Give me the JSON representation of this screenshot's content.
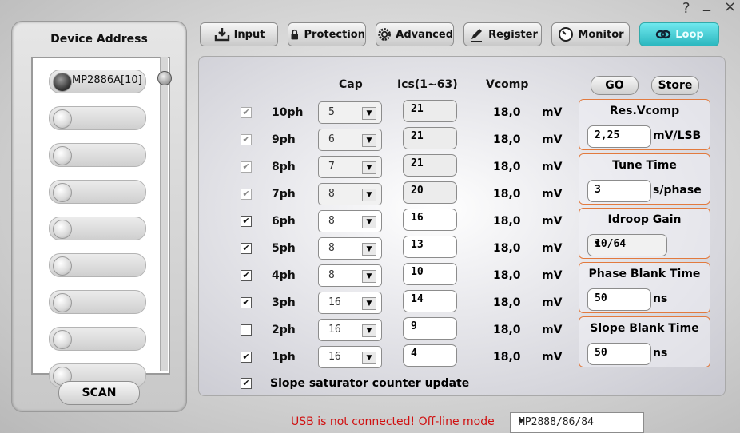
{
  "window": {
    "help_glyph": "?",
    "minimize_glyph": "_",
    "close_glyph": "×"
  },
  "device_panel": {
    "title": "Device Address",
    "devices": [
      "MP2886A[10]",
      "",
      "",
      "",
      "",
      "",
      "",
      "",
      ""
    ],
    "scan_label": "SCAN"
  },
  "tabs": [
    {
      "label": "Input",
      "icon": "download-tray-icon"
    },
    {
      "label": "Protection",
      "icon": "lock-icon"
    },
    {
      "label": "Advanced",
      "icon": "gear-icon"
    },
    {
      "label": "Register",
      "icon": "pen-icon"
    },
    {
      "label": "Monitor",
      "icon": "gauge-icon"
    },
    {
      "label": "Loop",
      "icon": "loop-link-icon",
      "active": true
    }
  ],
  "table": {
    "headers": {
      "cap": "Cap",
      "ics": "Ics(1~63)",
      "vcomp": "Vcomp"
    },
    "unit": "mV",
    "rows": [
      {
        "phase": "10ph",
        "checked": true,
        "enabled": false,
        "cap": "5",
        "ics": "21",
        "vcomp": "18,0"
      },
      {
        "phase": "9ph",
        "checked": true,
        "enabled": false,
        "cap": "6",
        "ics": "21",
        "vcomp": "18,0"
      },
      {
        "phase": "8ph",
        "checked": true,
        "enabled": false,
        "cap": "7",
        "ics": "21",
        "vcomp": "18,0"
      },
      {
        "phase": "7ph",
        "checked": true,
        "enabled": false,
        "cap": "8",
        "ics": "20",
        "vcomp": "18,0"
      },
      {
        "phase": "6ph",
        "checked": true,
        "enabled": true,
        "cap": "8",
        "ics": "16",
        "vcomp": "18,0"
      },
      {
        "phase": "5ph",
        "checked": true,
        "enabled": true,
        "cap": "8",
        "ics": "13",
        "vcomp": "18,0"
      },
      {
        "phase": "4ph",
        "checked": true,
        "enabled": true,
        "cap": "8",
        "ics": "10",
        "vcomp": "18,0"
      },
      {
        "phase": "3ph",
        "checked": true,
        "enabled": true,
        "cap": "16",
        "ics": "14",
        "vcomp": "18,0"
      },
      {
        "phase": "2ph",
        "checked": false,
        "enabled": true,
        "cap": "16",
        "ics": "9",
        "vcomp": "18,0"
      },
      {
        "phase": "1ph",
        "checked": true,
        "enabled": true,
        "cap": "16",
        "ics": "4",
        "vcomp": "18,0"
      }
    ],
    "slope_checkbox": {
      "checked": true,
      "label": "Slope saturator counter update"
    }
  },
  "actions": {
    "go": "GO",
    "store": "Store"
  },
  "settings": [
    {
      "title": "Res.Vcomp",
      "value": "2,25",
      "unit": "mV/LSB"
    },
    {
      "title": "Tune Time",
      "value": "3",
      "unit": "s/phase"
    },
    {
      "title": "Idroop Gain",
      "value": "10/64",
      "unit": "",
      "dropdown": true
    },
    {
      "title": "Phase Blank Time",
      "value": "50",
      "unit": "ns"
    },
    {
      "title": "Slope Blank Time",
      "value": "50",
      "unit": "ns"
    }
  ],
  "status": {
    "message": "USB is not connected! Off-line mode",
    "model": "MP2888/86/84"
  },
  "colors": {
    "accent_tab": "#2bb7bf",
    "status_text": "#d01010",
    "group_border": "#e27a3e"
  }
}
